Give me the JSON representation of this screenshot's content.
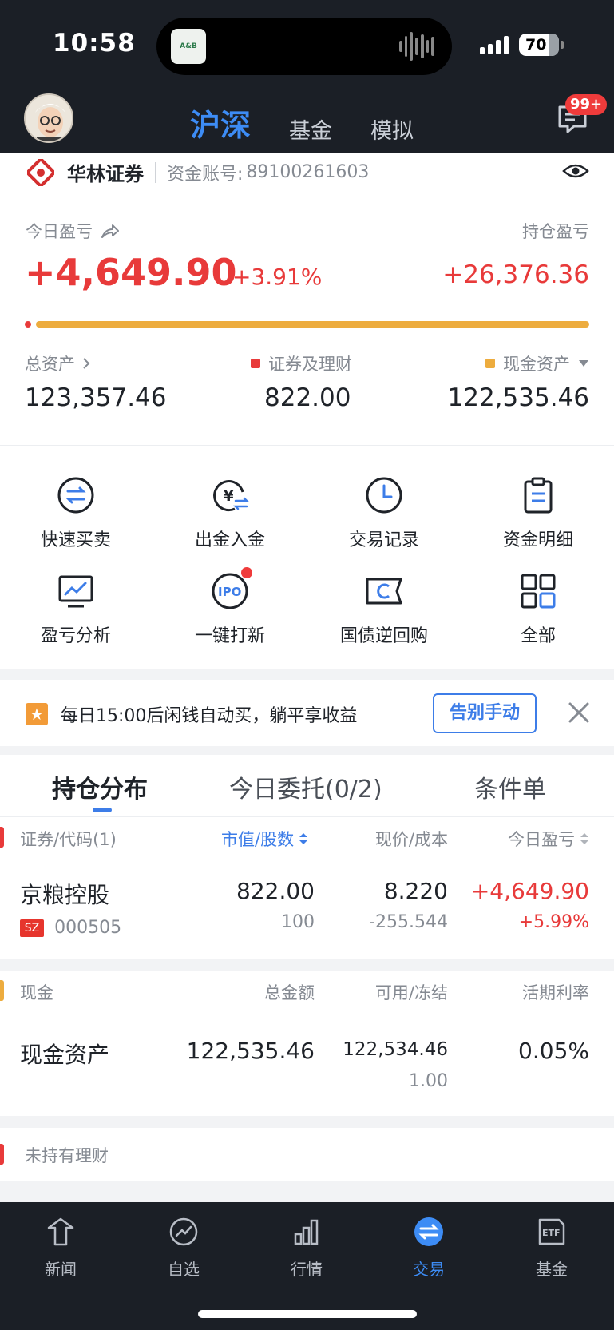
{
  "status_bar": {
    "time": "10:58",
    "battery": "70"
  },
  "header": {
    "tabs": [
      {
        "label": "沪深",
        "active": true
      },
      {
        "label": "基金",
        "active": false
      },
      {
        "label": "模拟",
        "active": false
      }
    ],
    "message_badge": "99+"
  },
  "account": {
    "broker": "华林证券",
    "account_label": "资金账号:",
    "account_no": "89100261603",
    "today_pl_label": "今日盈亏",
    "today_pl_value": "+4,649.90",
    "today_pl_pct": "+3.91%",
    "holding_pl_label": "持仓盈亏",
    "holding_pl_value": "+26,376.36",
    "securities_share": 0.0067,
    "total_assets_label": "总资产",
    "total_assets_value": "123,357.46",
    "securities_label": "证券及理财",
    "securities_value": "822.00",
    "cash_label": "现金资产",
    "cash_value": "122,535.46",
    "colors": {
      "up": "#e83a3a",
      "cash": "#edac3e"
    }
  },
  "actions": [
    {
      "label": "快速买卖",
      "icon": "swap-icon"
    },
    {
      "label": "出金入金",
      "icon": "yuan-transfer-icon"
    },
    {
      "label": "交易记录",
      "icon": "clock-icon"
    },
    {
      "label": "资金明细",
      "icon": "clipboard-icon"
    },
    {
      "label": "盈亏分析",
      "icon": "monitor-chart-icon"
    },
    {
      "label": "一键打新",
      "icon": "ipo-icon"
    },
    {
      "label": "国债逆回购",
      "icon": "ticket-icon"
    },
    {
      "label": "全部",
      "icon": "grid-icon"
    }
  ],
  "banner": {
    "text": "每日15:00后闲钱自动买，躺平享收益",
    "button": "告别手动"
  },
  "position_tabs": [
    {
      "label": "持仓分布",
      "active": true
    },
    {
      "label": "今日委托(0/2)",
      "active": false
    },
    {
      "label": "条件单",
      "active": false
    }
  ],
  "holdings": {
    "headers": [
      "证券/代码(1)",
      "市值/股数",
      "现价/成本",
      "今日盈亏"
    ],
    "rows": [
      {
        "name": "京粮控股",
        "market": "SZ",
        "code": "000505",
        "market_value": "822.00",
        "shares": "100",
        "price": "8.220",
        "cost": "-255.544",
        "today_pl": "+4,649.90",
        "today_pl_pct": "+5.99%"
      }
    ]
  },
  "cash": {
    "headers": [
      "现金",
      "总金额",
      "可用/冻结",
      "活期利率"
    ],
    "name": "现金资产",
    "total": "122,535.46",
    "available": "122,534.46",
    "frozen": "1.00",
    "rate": "0.05%"
  },
  "wealth": {
    "label": "未持有理财"
  },
  "bottom_nav": [
    {
      "label": "新闻",
      "active": false
    },
    {
      "label": "自选",
      "active": false
    },
    {
      "label": "行情",
      "active": false
    },
    {
      "label": "交易",
      "active": true
    },
    {
      "label": "基金",
      "active": false
    }
  ]
}
